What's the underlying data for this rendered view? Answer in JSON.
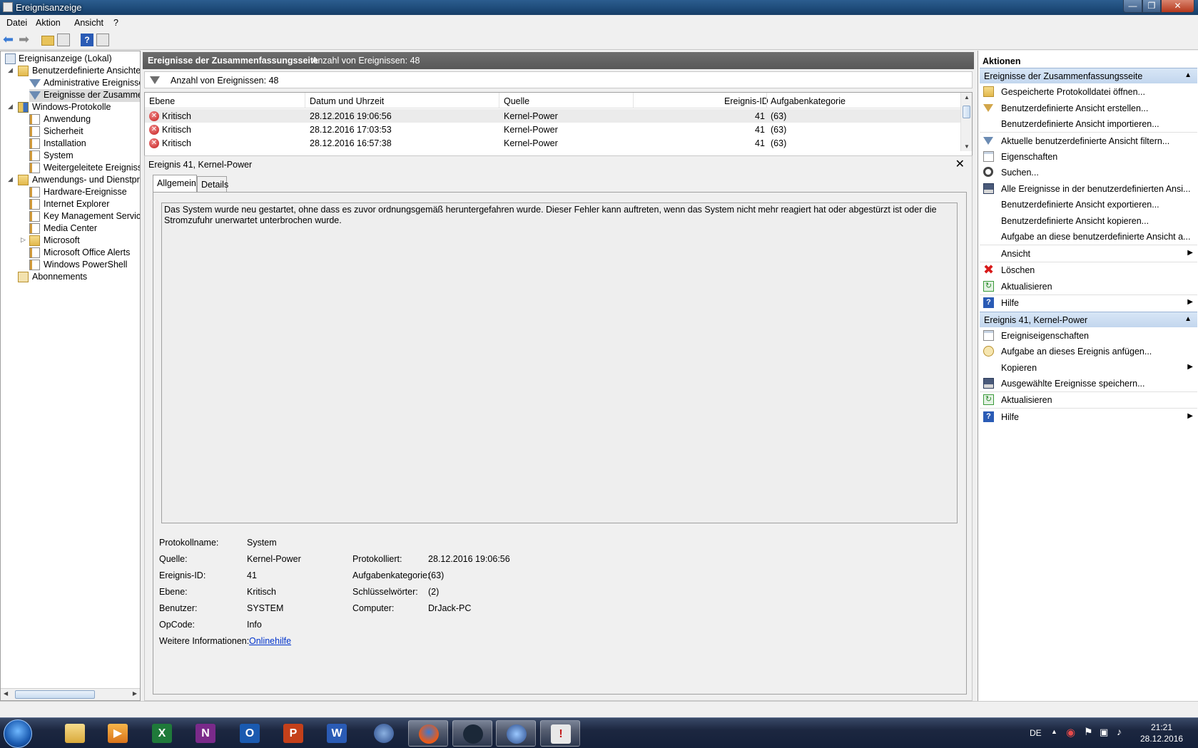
{
  "window": {
    "title": "Ereignisanzeige"
  },
  "menu": [
    "Datei",
    "Aktion",
    "Ansicht",
    "?"
  ],
  "tree": {
    "root": "Ereignisanzeige (Lokal)",
    "custom_views": "Benutzerdefinierte Ansichten",
    "admin_events": "Administrative Ereignisse",
    "summary_events": "Ereignisse der Zusammenfassungsseite",
    "windows_logs": "Windows-Protokolle",
    "win_items": [
      "Anwendung",
      "Sicherheit",
      "Installation",
      "System",
      "Weitergeleitete Ereignisse"
    ],
    "app_logs": "Anwendungs- und Dienstprotokolle",
    "app_items": [
      "Hardware-Ereignisse",
      "Internet Explorer",
      "Key Management Service",
      "Media Center",
      "Microsoft",
      "Microsoft Office Alerts",
      "Windows PowerShell"
    ],
    "subscriptions": "Abonnements"
  },
  "center": {
    "header_title": "Ereignisse der Zusammenfassungsseite",
    "header_count": "Anzahl von Ereignissen: 48",
    "filter_text": "Anzahl von Ereignissen: 48",
    "columns": [
      "Ebene",
      "Datum und Uhrzeit",
      "Quelle",
      "Ereignis-ID",
      "Aufgabenkategorie"
    ],
    "rows": [
      {
        "level": "Kritisch",
        "date": "28.12.2016 19:06:56",
        "source": "Kernel-Power",
        "id": "41",
        "category": "(63)"
      },
      {
        "level": "Kritisch",
        "date": "28.12.2016 17:03:53",
        "source": "Kernel-Power",
        "id": "41",
        "category": "(63)"
      },
      {
        "level": "Kritisch",
        "date": "28.12.2016 16:57:38",
        "source": "Kernel-Power",
        "id": "41",
        "category": "(63)"
      }
    ]
  },
  "detail": {
    "title": "Ereignis 41, Kernel-Power",
    "close": "✕",
    "tabs": [
      "Allgemein",
      "Details"
    ],
    "description": "Das System wurde neu gestartet, ohne dass es zuvor ordnungsgemäß heruntergefahren wurde. Dieser Fehler kann auftreten, wenn das System nicht mehr reagiert hat oder abgestürzt ist oder die Stromzufuhr unerwartet unterbrochen wurde.",
    "labels": {
      "log_name": "Protokollname:",
      "source": "Quelle:",
      "event_id": "Ereignis-ID:",
      "level": "Ebene:",
      "user": "Benutzer:",
      "opcode": "OpCode:",
      "more_info": "Weitere Informationen:",
      "logged": "Protokolliert:",
      "task_category": "Aufgabenkategorie:",
      "keywords": "Schlüsselwörter:",
      "computer": "Computer:"
    },
    "values": {
      "log_name": "System",
      "source": "Kernel-Power",
      "event_id": "41",
      "level": "Kritisch",
      "user": "SYSTEM",
      "opcode": "Info",
      "more_info": "Onlinehilfe",
      "logged": "28.12.2016 19:06:56",
      "task_category": "(63)",
      "keywords": "(2)",
      "computer": "DrJack-PC"
    }
  },
  "actions": {
    "title": "Aktionen",
    "section1": "Ereignisse der Zusammenfassungsseite",
    "items1": [
      "Gespeicherte Protokolldatei öffnen...",
      "Benutzerdefinierte Ansicht erstellen...",
      "Benutzerdefinierte Ansicht importieren...",
      "Aktuelle benutzerdefinierte Ansicht filtern...",
      "Eigenschaften",
      "Suchen...",
      "Alle Ereignisse in der benutzerdefinierten Ansi...",
      "Benutzerdefinierte Ansicht exportieren...",
      "Benutzerdefinierte Ansicht kopieren...",
      "Aufgabe an diese benutzerdefinierte Ansicht a...",
      "Ansicht",
      "Löschen",
      "Aktualisieren",
      "Hilfe"
    ],
    "section2": "Ereignis 41, Kernel-Power",
    "items2": [
      "Ereigniseigenschaften",
      "Aufgabe an dieses Ereignis anfügen...",
      "Kopieren",
      "Ausgewählte Ereignisse speichern...",
      "Aktualisieren",
      "Hilfe"
    ]
  },
  "taskbar": {
    "language": "DE",
    "time": "21:21",
    "date": "28.12.2016"
  }
}
